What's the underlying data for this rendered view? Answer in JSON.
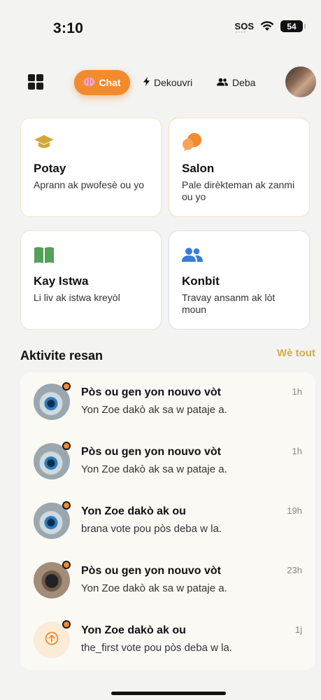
{
  "status_bar": {
    "time": "3:10",
    "sos": "SOS",
    "battery": "54"
  },
  "nav": {
    "tabs": [
      {
        "label": "Chat",
        "icon": "brain-icon",
        "active": true
      },
      {
        "label": "Dekouvri",
        "icon": "lightning-icon"
      },
      {
        "label": "Deba",
        "icon": "people-icon"
      }
    ],
    "accent_color": "#f28a2e"
  },
  "cards": [
    {
      "title": "Potay",
      "desc": "Aprann ak pwofesè ou yo",
      "icon": "graduation-cap-icon",
      "color": "#d4a63a"
    },
    {
      "title": "Salon",
      "desc": "Pale dirèkteman ak zanmi ou yo",
      "icon": "chat-bubbles-icon",
      "color": "#f28a2e"
    },
    {
      "title": "Kay Istwa",
      "desc": "Li liv ak istwa kreyòl",
      "icon": "book-icon",
      "color": "#55a05a"
    },
    {
      "title": "Konbit",
      "desc": "Travay ansanm ak lòt moun",
      "icon": "users-icon",
      "color": "#3b7bd6"
    }
  ],
  "activity": {
    "title": "Aktivite resan",
    "see_all": "Wè tout",
    "items": [
      {
        "title": "Pòs ou gen yon nouvo vòt",
        "subtitle": "Yon Zoe dakò ak sa w pataje a.",
        "time": "1h",
        "avatar": "eye"
      },
      {
        "title": "Pòs ou gen yon nouvo vòt",
        "subtitle": "Yon Zoe dakò ak sa w pataje a.",
        "time": "1h",
        "avatar": "eye"
      },
      {
        "title": "Yon Zoe dakò ak ou",
        "subtitle": "brana vote pou pòs deba w la.",
        "time": "19h",
        "avatar": "eye"
      },
      {
        "title": "Pòs ou gen yon nouvo vòt",
        "subtitle": "Yon Zoe dakò ak sa w pataje a.",
        "time": "23h",
        "avatar": "bug"
      },
      {
        "title": "Yon Zoe dakò ak ou",
        "subtitle": "the_first vote pou pòs deba w la.",
        "time": "1j",
        "avatar": "upvote"
      }
    ]
  }
}
